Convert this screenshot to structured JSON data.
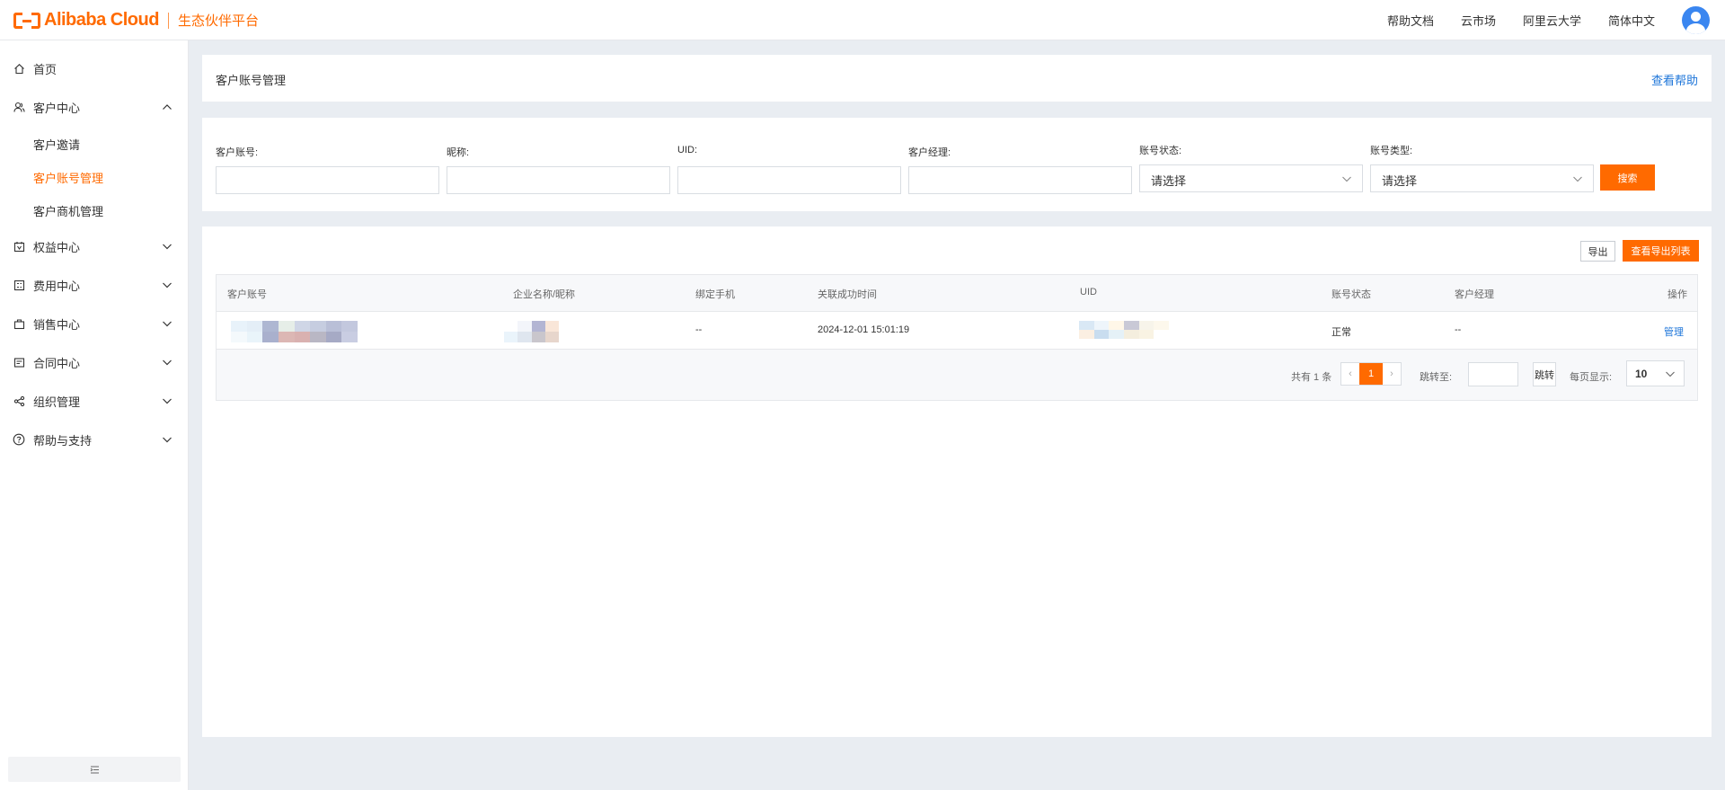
{
  "brand": {
    "name": "Alibaba Cloud",
    "subtitle": "生态伙伴平台",
    "accent": "#ff6a00"
  },
  "header": {
    "links": [
      "帮助文档",
      "云市场",
      "阿里云大学",
      "简体中文"
    ]
  },
  "sidebar": {
    "items": [
      {
        "label": "首页",
        "icon": "home-icon"
      },
      {
        "label": "客户中心",
        "icon": "customer-icon",
        "expanded": true,
        "children": [
          {
            "label": "客户邀请",
            "active": false
          },
          {
            "label": "客户账号管理",
            "active": true
          },
          {
            "label": "客户商机管理",
            "active": false
          }
        ]
      },
      {
        "label": "权益中心",
        "icon": "rights-icon"
      },
      {
        "label": "费用中心",
        "icon": "fee-icon"
      },
      {
        "label": "销售中心",
        "icon": "sales-icon"
      },
      {
        "label": "合同中心",
        "icon": "contract-icon"
      },
      {
        "label": "组织管理",
        "icon": "org-icon"
      },
      {
        "label": "帮助与支持",
        "icon": "help-icon"
      }
    ]
  },
  "page": {
    "title": "客户账号管理",
    "help_link": "查看帮助"
  },
  "filters": {
    "account_label": "客户账号:",
    "nickname_label": "昵称:",
    "uid_label": "UID:",
    "manager_label": "客户经理:",
    "status_label": "账号状态:",
    "status_value": "请选择",
    "type_label": "账号类型:",
    "type_value": "请选择",
    "search_button": "搜索"
  },
  "actions": {
    "export": "导出",
    "export_list": "查看导出列表"
  },
  "table": {
    "columns": [
      "客户账号",
      "企业名称/昵称",
      "绑定手机",
      "关联成功时间",
      "UID",
      "账号状态",
      "客户经理",
      "操作"
    ],
    "rows": [
      {
        "phone": "--",
        "time": "2024-12-01 15:01:19",
        "status": "正常",
        "manager": "--",
        "action": "管理"
      }
    ]
  },
  "pagination": {
    "total": "共有 1 条",
    "prev": "‹",
    "current": "1",
    "next": "›",
    "jump_label": "跳转至:",
    "jump_button": "跳转",
    "size_label": "每页显示:",
    "size_value": "10"
  }
}
